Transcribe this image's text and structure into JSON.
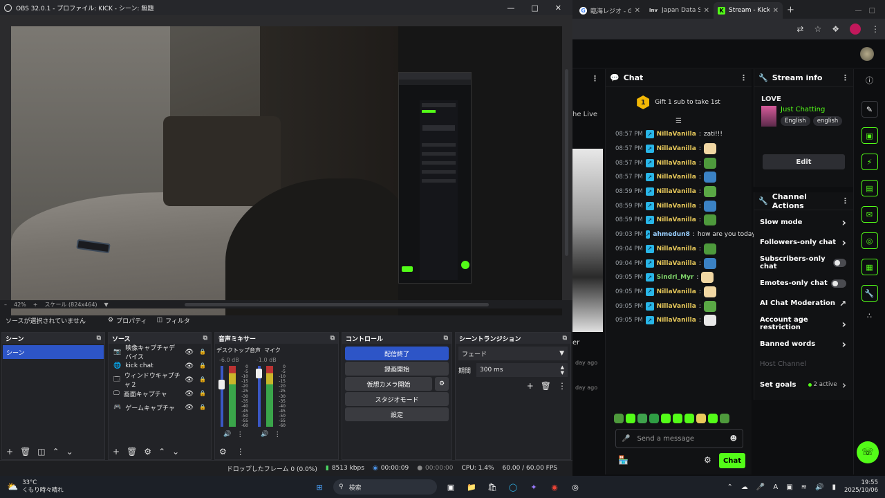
{
  "obs": {
    "title": "OBS 32.0.1 - プロファイル: KICK - シーン: 無題",
    "menu_glyph": "ファ",
    "zoom": "42%",
    "scale": "スケール (824x464)",
    "no_source": "ソースが選択されていません",
    "properties": "プロパティ",
    "filters": "フィルタ",
    "docks": {
      "scenes": {
        "title": "シーン",
        "items": [
          "シーン"
        ]
      },
      "sources": {
        "title": "ソース",
        "items": [
          {
            "label": "映像キャプチャデバイス",
            "icon": "camera-icon"
          },
          {
            "label": "kick chat",
            "icon": "globe-icon"
          },
          {
            "label": "ウィンドウキャプチャ２",
            "icon": "window-icon"
          },
          {
            "label": "画面キャプチャ",
            "icon": "monitor-icon"
          },
          {
            "label": "ゲームキャプチャ",
            "icon": "gamepad-icon"
          }
        ]
      },
      "mixer": {
        "title": "音声ミキサー",
        "channels": [
          {
            "name": "デスクトップ音声",
            "db": "-6.0 dB"
          },
          {
            "name": "マイク",
            "db": "-1.0 dB"
          }
        ],
        "scale": [
          "0",
          "-5",
          "-10",
          "-15",
          "-20",
          "-25",
          "-30",
          "-35",
          "-40",
          "-45",
          "-50",
          "-55",
          "-60"
        ]
      },
      "controls": {
        "title": "コントロール",
        "buttons": [
          "配信終了",
          "録画開始",
          "仮想カメラ開始",
          "スタジオモード",
          "設定"
        ]
      },
      "transitions": {
        "title": "シーントランジション",
        "type": "フェード",
        "duration_label": "期間",
        "duration": "300 ms"
      }
    },
    "status": {
      "dropped": "ドロップしたフレーム 0 (0.0%)",
      "bitrate": "8513 kbps",
      "live_time": "00:00:09",
      "rec_time": "00:00:00",
      "cpu": "CPU: 1.4%",
      "fps": "60.00 / 60.00 FPS"
    }
  },
  "browser": {
    "tabs": [
      {
        "label": "臨海レジオ - Go",
        "favicon": "G"
      },
      {
        "label": "Japan Data Sci",
        "favicon": "Inv"
      },
      {
        "label": "Stream - Kick",
        "favicon": "K"
      }
    ],
    "new_tab": "+"
  },
  "kick": {
    "left_partial": {
      "live_text": "he Live",
      "er": "er",
      "ago1": "day ago",
      "ago2": "day ago"
    },
    "chat": {
      "title": "Chat",
      "gift_count": "1",
      "gift_text": "Gift 1 sub to take 1st",
      "messages": [
        {
          "time": "08:57 PM",
          "user": "NillaVanilla",
          "text": "zati!!!",
          "color": "#e8c95b",
          "emote": ""
        },
        {
          "time": "08:57 PM",
          "user": "NillaVanilla",
          "text": "",
          "color": "#e8c95b",
          "emote": "#f1d7a3"
        },
        {
          "time": "08:57 PM",
          "user": "NillaVanilla",
          "text": "",
          "color": "#e8c95b",
          "emote": "#4e9a3c"
        },
        {
          "time": "08:57 PM",
          "user": "NillaVanilla",
          "text": "",
          "color": "#e8c95b",
          "emote": "#3b82c4"
        },
        {
          "time": "08:59 PM",
          "user": "NillaVanilla",
          "text": "",
          "color": "#e8c95b",
          "emote": "#5aa845"
        },
        {
          "time": "08:59 PM",
          "user": "NillaVanilla",
          "text": "",
          "color": "#e8c95b",
          "emote": "#3b82c4"
        },
        {
          "time": "08:59 PM",
          "user": "NillaVanilla",
          "text": "",
          "color": "#e8c95b",
          "emote": "#4e9a3c"
        },
        {
          "time": "09:03 PM",
          "user": "ahmedun8",
          "text": "how are you today",
          "color": "#9ad0ff",
          "emote": ""
        },
        {
          "time": "09:04 PM",
          "user": "NillaVanilla",
          "text": "",
          "color": "#e8c95b",
          "emote": "#4e9a3c"
        },
        {
          "time": "09:04 PM",
          "user": "NillaVanilla",
          "text": "",
          "color": "#e8c95b",
          "emote": "#3b82c4"
        },
        {
          "time": "09:05 PM",
          "user": "Sindri_Myr",
          "text": "",
          "color": "#7fd46a",
          "emote": "#f1d7a3"
        },
        {
          "time": "09:05 PM",
          "user": "NillaVanilla",
          "text": "",
          "color": "#e8c95b",
          "emote": "#f1d7a3"
        },
        {
          "time": "09:05 PM",
          "user": "NillaVanilla",
          "text": "",
          "color": "#e8c95b",
          "emote": "#5aa845"
        },
        {
          "time": "09:05 PM",
          "user": "NillaVanilla",
          "text": "",
          "color": "#e8c95b",
          "emote": "#e8e8e8"
        }
      ],
      "placeholder": "Send a message",
      "send": "Chat"
    },
    "stream_info": {
      "title": "Stream info",
      "stream_title": "LOVE",
      "category": "Just Chatting",
      "tags": [
        "English",
        "english"
      ],
      "edit": "Edit"
    },
    "channel_actions": {
      "title": "Channel Actions",
      "items": [
        {
          "label": "Slow mode",
          "kind": "chevron"
        },
        {
          "label": "Followers-only chat",
          "kind": "chevron"
        },
        {
          "label": "Subscribers-only chat",
          "kind": "toggle"
        },
        {
          "label": "Emotes-only chat",
          "kind": "toggle"
        },
        {
          "label": "AI Chat Moderation",
          "kind": "external"
        },
        {
          "label": "Account age restriction",
          "kind": "chevron"
        },
        {
          "label": "Banned words",
          "kind": "chevron"
        },
        {
          "label": "Host Channel",
          "kind": "disabled"
        },
        {
          "label": "Set goals",
          "kind": "goals",
          "extra": "2 active"
        }
      ]
    },
    "accent": "#53fc18"
  },
  "taskbar": {
    "weather_temp": "33°C",
    "weather_desc": "くもり時々晴れ",
    "search": "検索",
    "time": "19:55",
    "date": "2025/10/06",
    "ime": "A"
  }
}
